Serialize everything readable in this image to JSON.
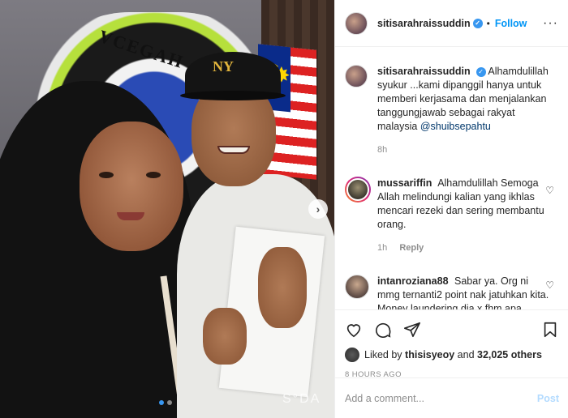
{
  "post": {
    "username": "sitisarahraissuddin",
    "verified_icon": "verified-badge-icon",
    "separator": "•",
    "follow_label": "Follow",
    "more_icon": "ellipsis-icon",
    "more_label": "···",
    "watermark": "S°DA"
  },
  "caption": {
    "username": "sitisarahraissuddin",
    "text": "Alhamdulillah syukur ...kami dipanggil hanya untuk memberi kerjasama dan menjalankan tanggungjawab sebagai rakyat malaysia",
    "mention": "@shuibsepahtu",
    "time": "8h"
  },
  "comments": [
    {
      "username": "mussariffin",
      "text": "Alhamdulillah Semoga Allah melindungi kalian yang ikhlas mencari rezeki dan sering membantu orang.",
      "time": "1h",
      "reply_label": "Reply"
    },
    {
      "username": "intanroziana88",
      "text": "Sabar ya. Org ni mmg ternanti2 point nak jatuhkan kita. Money laundering dia x fhm apa, konsep franchise dia x phm apa.. Ya dia tahu",
      "time": "",
      "reply_label": ""
    }
  ],
  "likes": {
    "prefix": "Liked by",
    "user": "thisisyeoy",
    "conjunction": "and",
    "count": "32,025 others"
  },
  "timestamp": "8 HOURS AGO",
  "composer": {
    "placeholder": "Add a comment...",
    "post_label": "Post"
  },
  "carousel": {
    "next_label": "›",
    "slide_count": 2,
    "active_slide": 1
  },
  "photo_signs": {
    "emblem_text": "VCEGAH",
    "cap_logo": "NY"
  },
  "colors": {
    "accent": "#0095f6",
    "verified": "#3897f0",
    "muted": "#8e8e8e",
    "post_disabled": "#b3dbff"
  }
}
